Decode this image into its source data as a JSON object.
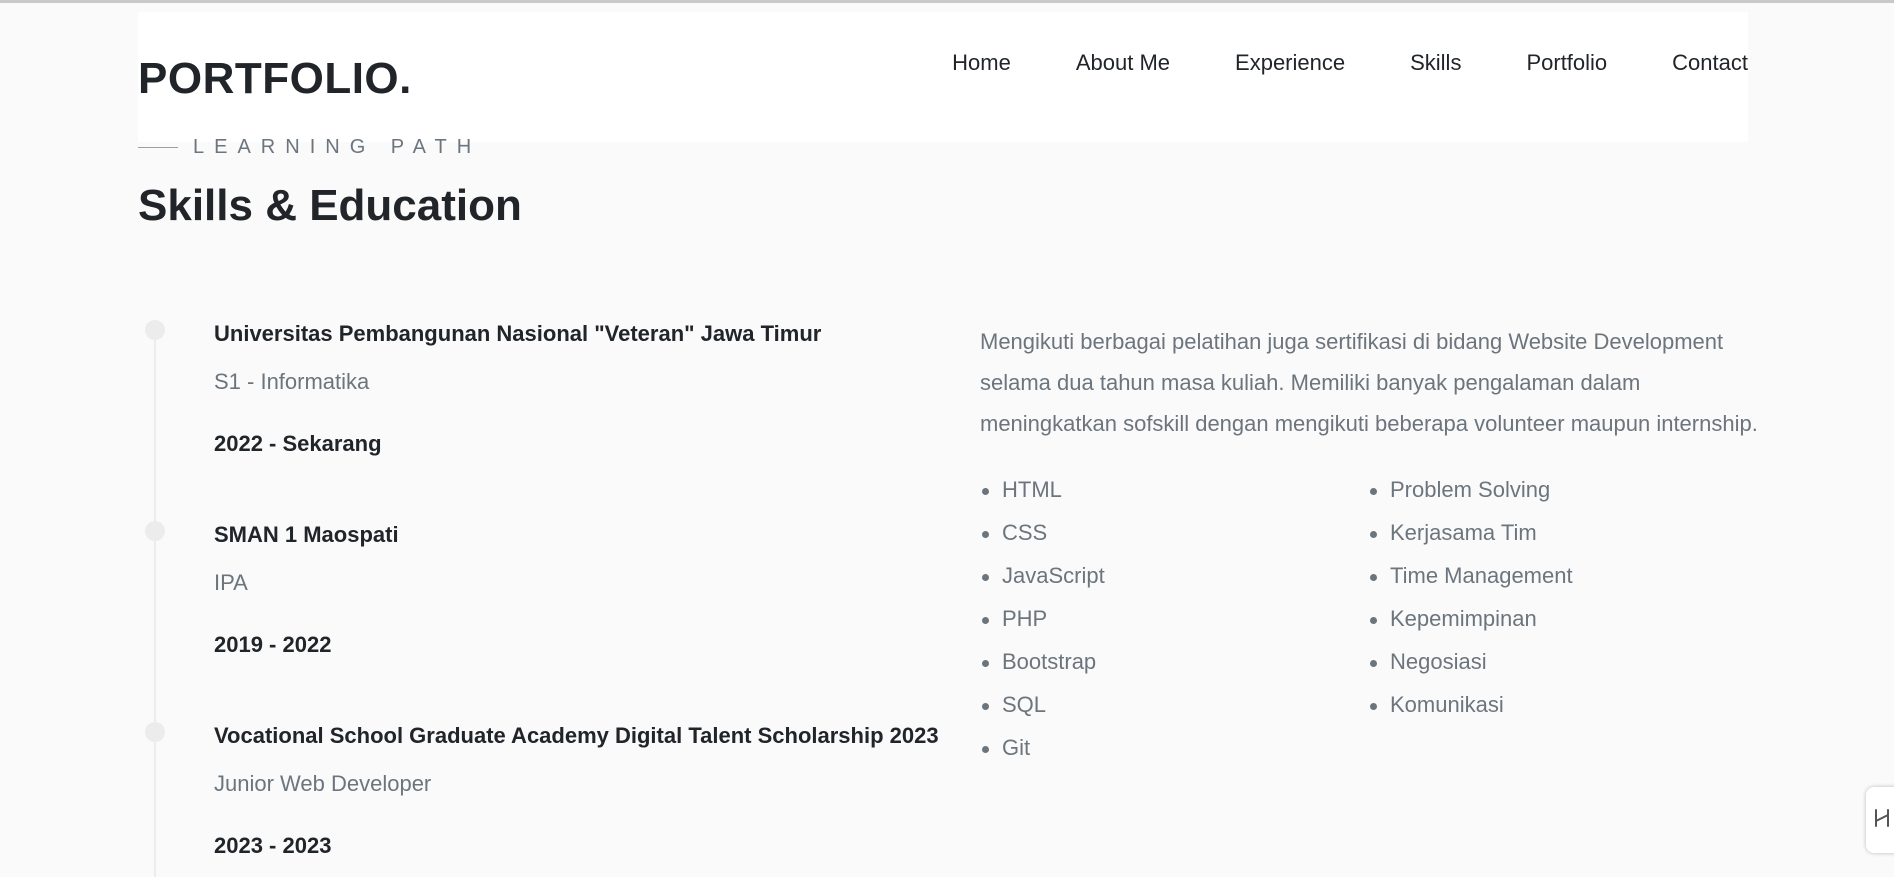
{
  "header": {
    "logo": "PORTFOLIO.",
    "nav": [
      "Home",
      "About Me",
      "Experience",
      "Skills",
      "Portfolio",
      "Contact"
    ]
  },
  "section": {
    "eyebrow": "LEARNING PATH",
    "title": "Skills & Education"
  },
  "education": [
    {
      "name": "Universitas Pembangunan Nasional \"Veteran\" Jawa Timur",
      "degree": "S1 - Informatika",
      "years": "2022 - Sekarang"
    },
    {
      "name": "SMAN 1 Maospati",
      "degree": "IPA",
      "years": "2019 - 2022"
    },
    {
      "name": "Vocational School Graduate Academy Digital Talent Scholarship 2023",
      "degree": "Junior Web Developer",
      "years": "2023 - 2023"
    }
  ],
  "about": {
    "text": "Mengikuti berbagai pelatihan juga sertifikasi di bidang Website Development selama dua tahun masa kuliah. Memiliki banyak pengalaman dalam meningkatkan sofskill dengan mengikuti beberapa volunteer maupun internship."
  },
  "skills": {
    "technical": [
      "HTML",
      "CSS",
      "JavaScript",
      "PHP",
      "Bootstrap",
      "SQL",
      "Git"
    ],
    "soft": [
      "Problem Solving",
      "Kerjasama Tim",
      "Time Management",
      "Kepemimpinan",
      "Negosiasi",
      "Komunikasi"
    ]
  },
  "widget": {
    "icon": "handle-icon"
  },
  "colors": {
    "text_dark": "#212529",
    "text_muted": "#6c757d",
    "timeline": "#ececec",
    "background": "#fafafa"
  }
}
